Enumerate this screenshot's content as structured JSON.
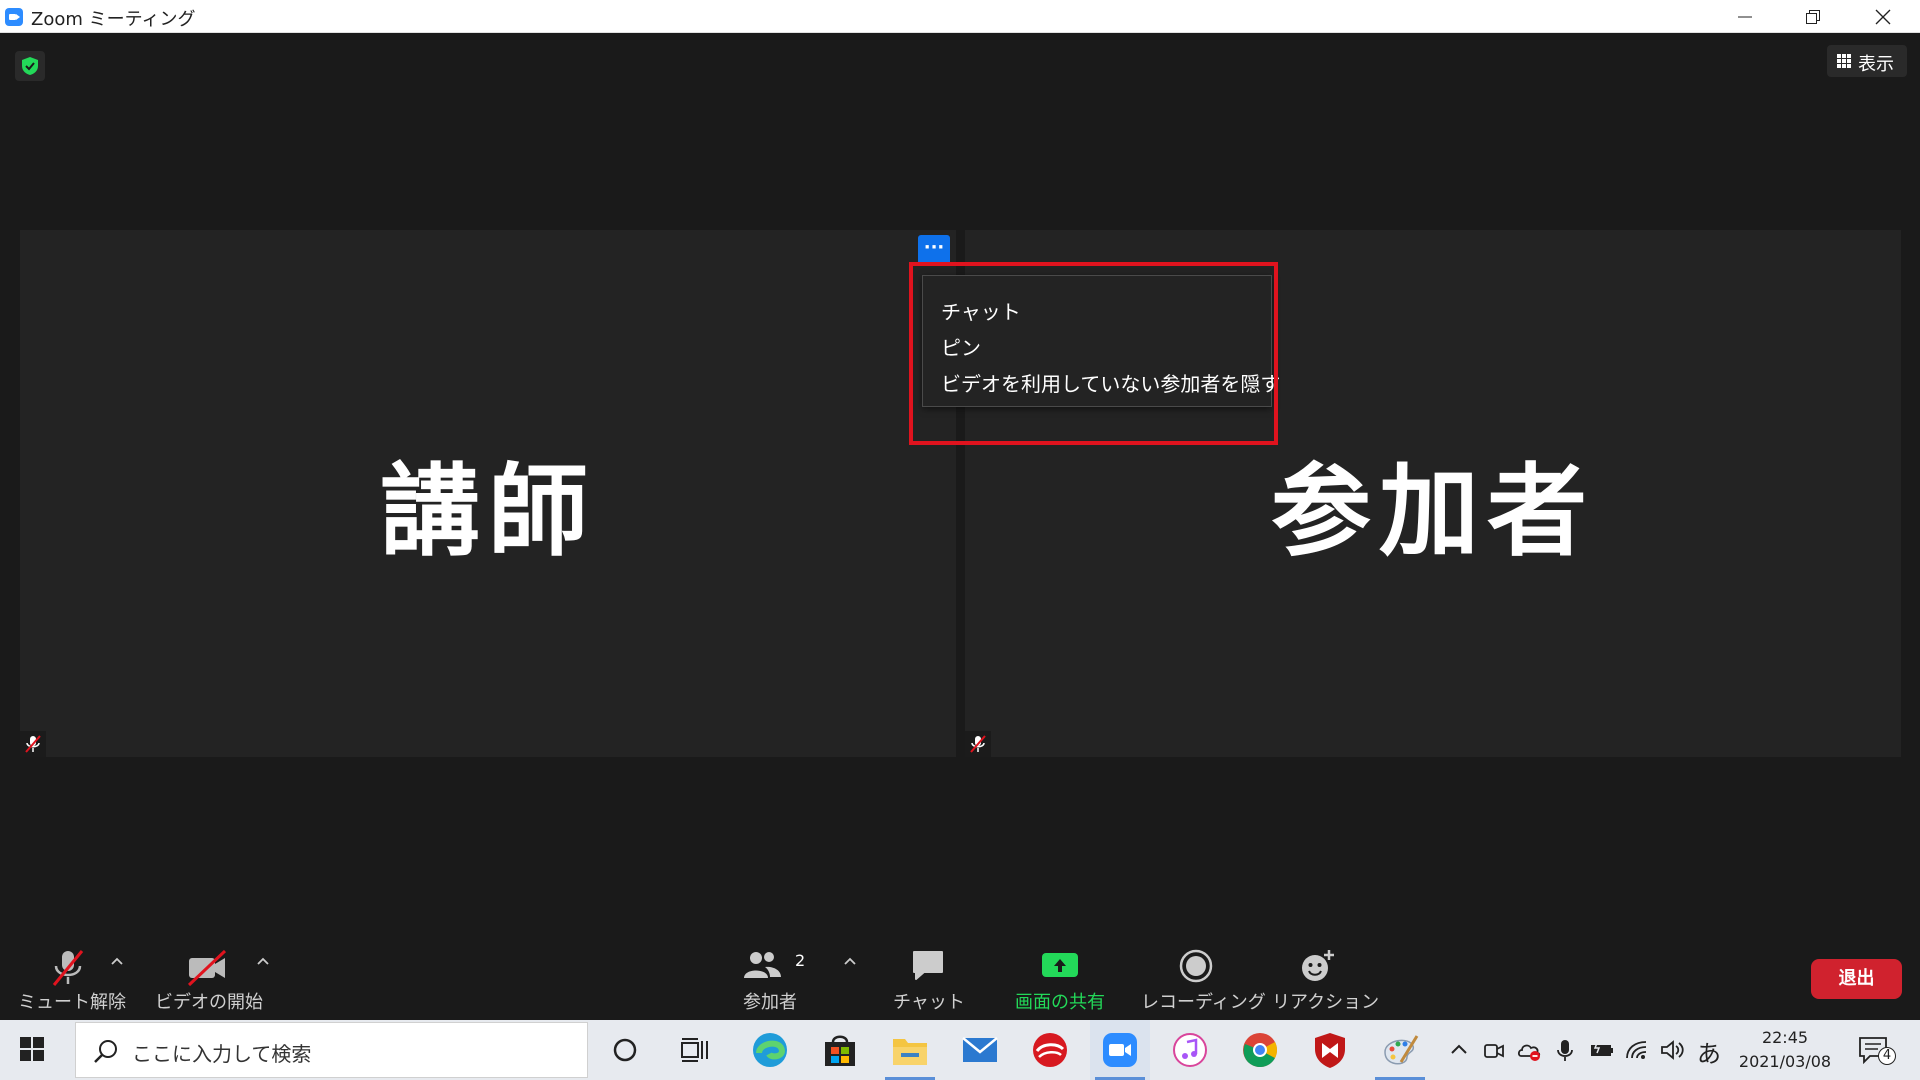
{
  "window": {
    "title": "Zoom ミーティング"
  },
  "header": {
    "view_label": "表示"
  },
  "tiles": [
    {
      "name": "講師"
    },
    {
      "name": "参加者"
    }
  ],
  "menu": {
    "button_label": "···",
    "items": [
      "チャット",
      "ピン",
      "ビデオを利用していない参加者を隠す"
    ]
  },
  "toolbar": {
    "unmute_label": "ミュート解除",
    "video_label": "ビデオの開始",
    "participants_label": "参加者",
    "participants_count": "2",
    "chat_label": "チャット",
    "share_label": "画面の共有",
    "record_label": "レコーディング",
    "reaction_label": "リアクション",
    "leave_label": "退出"
  },
  "taskbar": {
    "search_placeholder": "ここに入力して検索",
    "ime": "あ",
    "time": "22:45",
    "date": "2021/03/08",
    "notification_count": "4"
  },
  "colors": {
    "share_green": "#23d959",
    "leave_red": "#d0222e",
    "menu_highlight": "#e0131e",
    "accent_blue": "#0e71eb"
  }
}
